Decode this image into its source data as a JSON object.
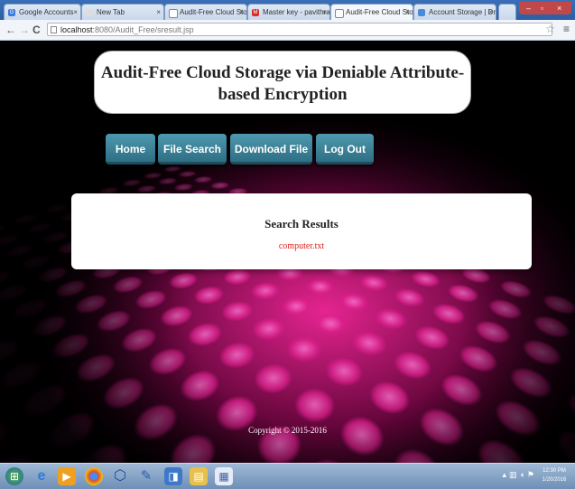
{
  "browser": {
    "tabs": [
      {
        "label": "Google Accounts",
        "icon": "google-icon",
        "color": "#3b7ddd"
      },
      {
        "label": "New Tab",
        "icon": "blank-page-icon",
        "color": "#cccccc"
      },
      {
        "label": "Audit-Free Cloud Storage",
        "icon": "page-icon",
        "color": "#cccccc"
      },
      {
        "label": "Master key - pavithrapini",
        "icon": "gmail-icon",
        "color": "#d93025"
      },
      {
        "label": "Audit-Free Cloud Storage",
        "icon": "page-icon",
        "color": "#cccccc",
        "active": true
      },
      {
        "label": "Account Storage | DriveH",
        "icon": "drive-icon",
        "color": "#4a8ad6"
      }
    ],
    "url_host": "localhost",
    "url_path": ":8080/Audit_Free/sresult.jsp"
  },
  "page": {
    "title": "Audit-Free Cloud Storage via Deniable Attribute-based Encryption",
    "nav": [
      "Home",
      "File Search",
      "Download File",
      "Log Out"
    ],
    "results_heading": "Search Results",
    "result_file": "computer.txt",
    "copyright": "Copyright © 2015-2016"
  },
  "taskbar": {
    "clock_time": "12:30 PM",
    "clock_date": "1/20/2016"
  },
  "colors": {
    "nav_button": "#3f8aa0",
    "result_link": "#e0201a",
    "accent_pink": "#ff28a0"
  }
}
